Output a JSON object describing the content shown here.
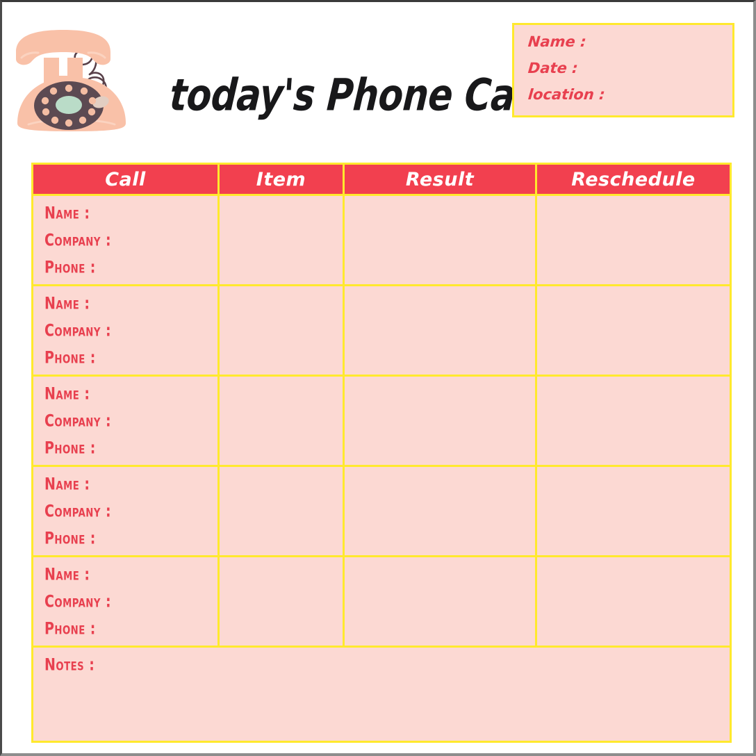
{
  "document": {
    "title": "today's Phone Calls"
  },
  "info_box": {
    "lines": [
      {
        "label": "Name :"
      },
      {
        "label": "Date :"
      },
      {
        "label": "location :"
      }
    ]
  },
  "illustration": {
    "name": "rotary-phone-illustration",
    "body_color": "#F9C1A8",
    "body_shade": "#F7B79C",
    "dial_color": "#5C4A52",
    "dial_center_color": "#BADCC8",
    "dial_hole_color": "#F4BDA3",
    "cord_color": "#584049",
    "handset_highlight": "#FAD3C1"
  },
  "table": {
    "columns": [
      {
        "key": "call",
        "label": "Call"
      },
      {
        "key": "item",
        "label": "Item"
      },
      {
        "key": "result",
        "label": "Result"
      },
      {
        "key": "reschedule",
        "label": "Reschedule"
      }
    ],
    "row_field_labels": [
      "Name :",
      "Company :",
      "Phone :"
    ],
    "rows": [
      {
        "call": {
          "name": "",
          "company": "",
          "phone": ""
        },
        "item": "",
        "result": "",
        "reschedule": ""
      },
      {
        "call": {
          "name": "",
          "company": "",
          "phone": ""
        },
        "item": "",
        "result": "",
        "reschedule": ""
      },
      {
        "call": {
          "name": "",
          "company": "",
          "phone": ""
        },
        "item": "",
        "result": "",
        "reschedule": ""
      },
      {
        "call": {
          "name": "",
          "company": "",
          "phone": ""
        },
        "item": "",
        "result": "",
        "reschedule": ""
      },
      {
        "call": {
          "name": "",
          "company": "",
          "phone": ""
        },
        "item": "",
        "result": "",
        "reschedule": ""
      }
    ],
    "notes": {
      "label": "Notes :",
      "value": ""
    }
  },
  "colors": {
    "header_red": "#F2404F",
    "border_yellow": "#FFE92D",
    "cell_pink": "#FCD9D3",
    "label_red": "#E8404F",
    "title_black": "#18181A",
    "page_white": "#FFFFFF",
    "frame_gray": "#8D8D8D"
  }
}
